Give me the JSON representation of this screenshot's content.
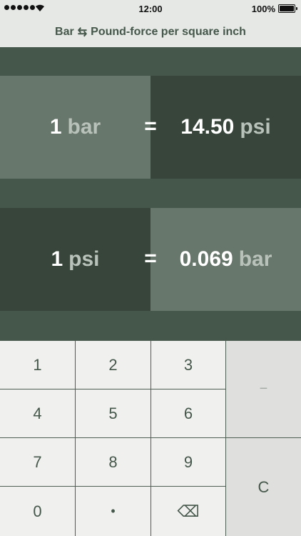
{
  "status_bar": {
    "time": "12:00",
    "battery": "100%"
  },
  "nav": {
    "from": "Bar",
    "swap_icon": "⇆",
    "to": "Pound-force per square inch"
  },
  "conversions": [
    {
      "input_value": "1",
      "input_unit": "bar",
      "equals": "=",
      "output_value": "14.50",
      "output_unit": "psi"
    },
    {
      "input_value": "1",
      "input_unit": "psi",
      "equals": "=",
      "output_value": "0.069",
      "output_unit": "bar"
    }
  ],
  "keypad": {
    "k1": "1",
    "k2": "2",
    "k3": "3",
    "k4": "4",
    "k5": "5",
    "k6": "6",
    "k7": "7",
    "k8": "8",
    "k9": "9",
    "k0": "0",
    "dot": "•",
    "backspace_icon": "⌫",
    "minus": "−",
    "clear": "C"
  }
}
